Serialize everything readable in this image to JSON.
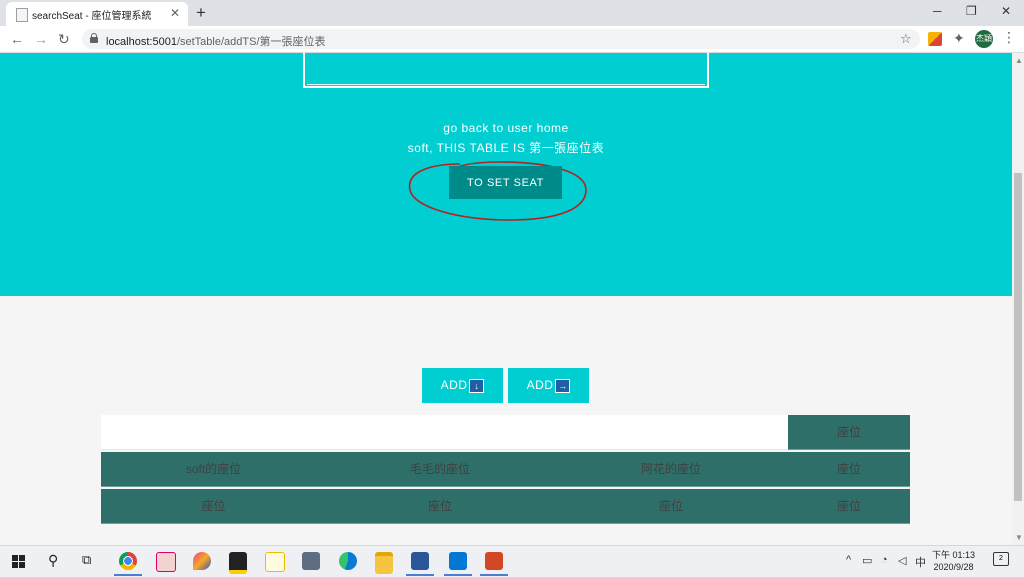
{
  "browser": {
    "tab_title": "searchSeat - 座位管理系統",
    "tab_close": "✕",
    "new_tab": "+",
    "url_host": "localhost:5001",
    "url_path": "/setTable/addTS/第一張座位表",
    "avatar_text": "杰穎",
    "window_controls": [
      "─",
      "❐",
      "✕"
    ]
  },
  "hero": {
    "back_link": "go back to user home",
    "subtitle": "soft, THIS TABLE IS 第一張座位表",
    "set_seat_button": "TO SET SEAT",
    "annotation_color": "#b22222"
  },
  "actions": {
    "add_down_label": "ADD",
    "add_down_icon": "↓",
    "add_right_label": "ADD",
    "add_right_icon": "→"
  },
  "seat_table": {
    "rows": [
      [
        "",
        "",
        "",
        "座位"
      ],
      [
        "soft的座位",
        "毛毛的座位",
        "阿花的座位",
        "座位"
      ],
      [
        "座位",
        "座位",
        "座位",
        "座位"
      ]
    ]
  },
  "taskbar": {
    "time": "下午 01:13",
    "date": "2020/9/28",
    "ime": "中",
    "notifications": "2"
  },
  "colors": {
    "hero_bg": "#00ced1",
    "button_dark": "#008b8b",
    "table_cell": "#2f6f6a"
  }
}
